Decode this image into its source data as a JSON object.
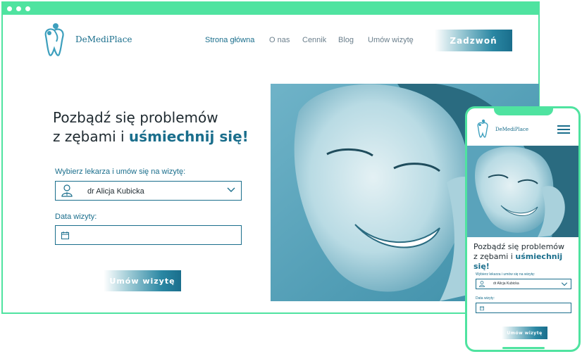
{
  "brand": {
    "name": "DeMediPlace",
    "logo_icon": "tooth-family-logo"
  },
  "nav": {
    "items": [
      {
        "label": "Strona główna",
        "active": true
      },
      {
        "label": "O nas",
        "active": false
      },
      {
        "label": "Cennik",
        "active": false
      },
      {
        "label": "Blog",
        "active": false
      },
      {
        "label": "Umów wizytę",
        "active": false
      }
    ],
    "call_label": "Zadzwoń"
  },
  "hero": {
    "title_line1": "Pozbądź się problemów",
    "title_line2_plain": "z zębami i ",
    "title_line2_highlight": "uśmiechnij się!"
  },
  "form": {
    "doctor_label": "Wybierz lekarza i umów się na wizytę:",
    "doctor_value": "dr Alicja Kubicka",
    "date_label": "Data wizyty:",
    "date_value": "",
    "submit_label": "Umów wizytę"
  },
  "colors": {
    "accent": "#1a6e8c",
    "frame": "#4fe3a0",
    "photo_tint": "#3d8ea8"
  },
  "icons": [
    "doctor-icon",
    "chevron-down-icon",
    "calendar-icon",
    "hamburger-menu-icon"
  ]
}
